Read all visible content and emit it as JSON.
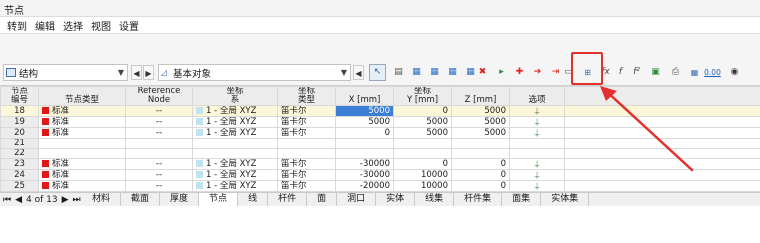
{
  "window": {
    "title": "节点"
  },
  "menu": [
    "转到",
    "编辑",
    "选择",
    "视图",
    "设置"
  ],
  "toolbar": {
    "combo1": "结构",
    "combo2": "基本对象",
    "icons": [
      "pointer-select-icon",
      "select-area-icon",
      "table-view-icon",
      "column-width-icon",
      "filter-icon",
      "hide-columns-icon",
      "delete-row-icon",
      "insert-row-icon",
      "delete-rows-icon",
      "move-rows-icon",
      "toggle-view-icon",
      "node-numbering-icon",
      "formula-icon",
      "function-icon",
      "function-sup-icon",
      "export-excel-icon",
      "print-table-icon",
      "units-icon",
      "decimal-places-icon",
      "search-icon"
    ],
    "units_label": "0.00",
    "highlight_color": "#e3312d"
  },
  "table": {
    "headers": {
      "no": [
        "节点",
        "编号"
      ],
      "type": "节点类型",
      "ref": [
        "Reference",
        "Node"
      ],
      "sys": [
        "坐标",
        "系"
      ],
      "coordtype": [
        "坐标",
        "类型"
      ],
      "coord_group": "坐标",
      "x": "X [mm]",
      "y": "Y [mm]",
      "z": "Z [mm]",
      "opt": "选项"
    },
    "rows": [
      {
        "no": "18",
        "type": "标准",
        "ref": "--",
        "sys": "1 - 全局 XYZ",
        "ct": "笛卡尔",
        "x": "5000",
        "y": "0",
        "z": "5000",
        "opt": true,
        "hl": true,
        "sel": true
      },
      {
        "no": "19",
        "type": "标准",
        "ref": "--",
        "sys": "1 - 全局 XYZ",
        "ct": "笛卡尔",
        "x": "5000",
        "y": "5000",
        "z": "5000",
        "opt": true
      },
      {
        "no": "20",
        "type": "标准",
        "ref": "--",
        "sys": "1 - 全局 XYZ",
        "ct": "笛卡尔",
        "x": "0",
        "y": "5000",
        "z": "5000",
        "opt": true
      },
      {
        "no": "21",
        "type": "",
        "ref": "",
        "sys": "",
        "ct": "",
        "x": "",
        "y": "",
        "z": "",
        "opt": false
      },
      {
        "no": "22",
        "type": "",
        "ref": "",
        "sys": "",
        "ct": "",
        "x": "",
        "y": "",
        "z": "",
        "opt": false
      },
      {
        "no": "23",
        "type": "标准",
        "ref": "--",
        "sys": "1 - 全局 XYZ",
        "ct": "笛卡尔",
        "x": "-30000",
        "y": "0",
        "z": "0",
        "opt": true
      },
      {
        "no": "24",
        "type": "标准",
        "ref": "--",
        "sys": "1 - 全局 XYZ",
        "ct": "笛卡尔",
        "x": "-30000",
        "y": "10000",
        "z": "0",
        "opt": true
      },
      {
        "no": "25",
        "type": "标准",
        "ref": "--",
        "sys": "1 - 全局 XYZ",
        "ct": "笛卡尔",
        "x": "-20000",
        "y": "10000",
        "z": "0",
        "opt": true
      }
    ],
    "node_color": "#e01818"
  },
  "status": {
    "page": "4 of 13",
    "tabs": [
      "材料",
      "截面",
      "厚度",
      "节点",
      "线",
      "杆件",
      "面",
      "洞口",
      "实体",
      "线集",
      "杆件集",
      "面集",
      "实体集"
    ],
    "active_tab": "节点"
  }
}
